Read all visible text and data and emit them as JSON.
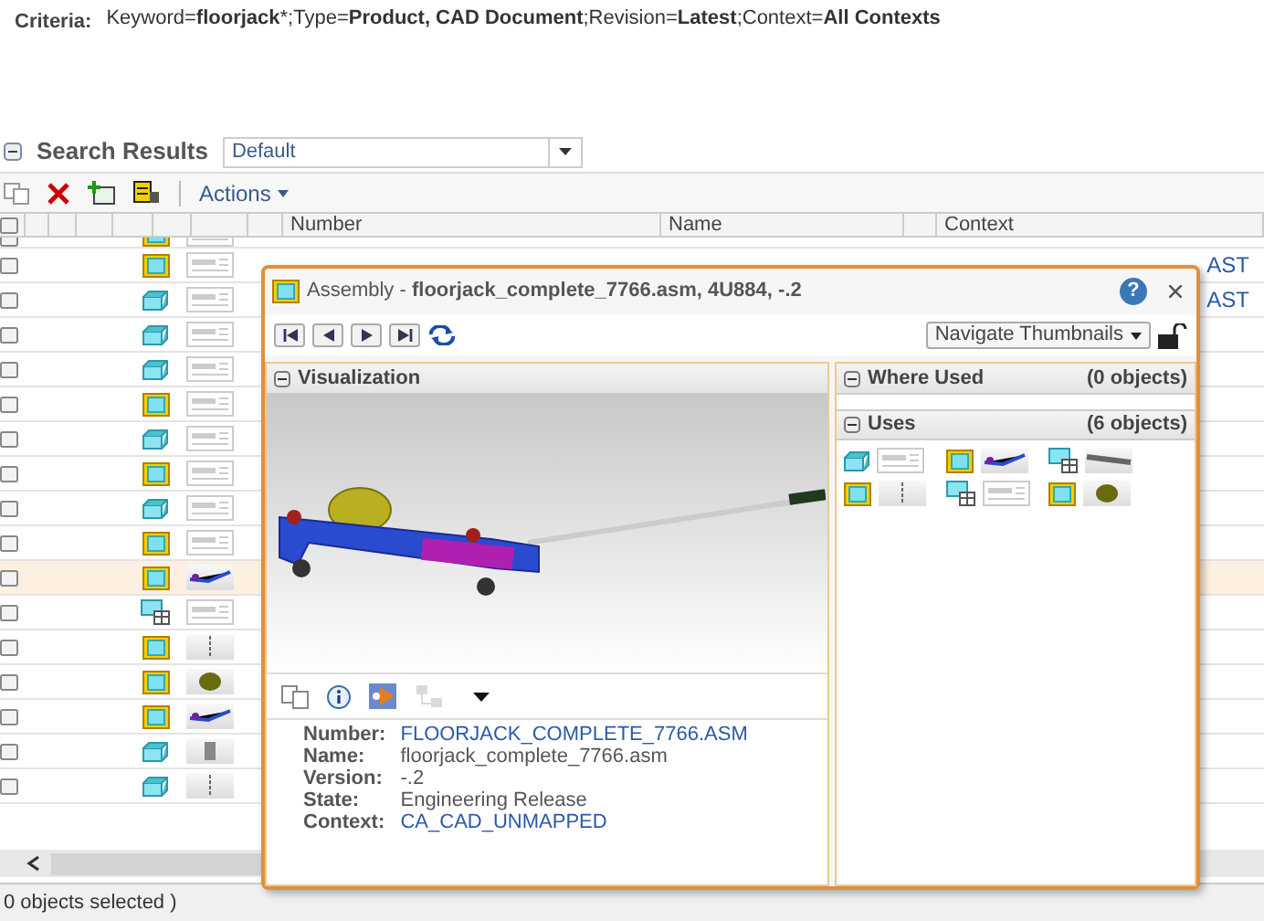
{
  "criteria": {
    "label": "Criteria:",
    "text": "Keyword=**floorjack***;Type=**Product, CAD Document**;Revision=**Latest**;Context=**All Contexts**"
  },
  "search_results": {
    "title": "Search Results",
    "view": "Default"
  },
  "toolbar": {
    "actions": "Actions"
  },
  "table": {
    "select_all_checked": false,
    "columns": [
      "Number",
      "Name",
      "Context"
    ],
    "rows": [
      {
        "cut": true,
        "kind": "assembly",
        "thumbnail": {
          "kind": "drawing"
        },
        "checked": false,
        "highlighted": false
      },
      {
        "kind": "assembly",
        "thumbnail": {
          "kind": "drawing"
        },
        "checked": false,
        "highlighted": false,
        "context": "AST"
      },
      {
        "kind": "part",
        "thumbnail": {
          "kind": "drawing"
        },
        "checked": false,
        "highlighted": false,
        "context": "AST"
      },
      {
        "kind": "part",
        "thumbnail": {
          "kind": "drawing"
        },
        "checked": false,
        "highlighted": false
      },
      {
        "kind": "part",
        "thumbnail": {
          "kind": "drawing"
        },
        "checked": false,
        "highlighted": false
      },
      {
        "kind": "assembly",
        "thumbnail": {
          "kind": "drawing"
        },
        "checked": false,
        "highlighted": false
      },
      {
        "kind": "part",
        "thumbnail": {
          "kind": "drawing"
        },
        "checked": false,
        "highlighted": false
      },
      {
        "kind": "assembly",
        "thumbnail": {
          "kind": "drawing"
        },
        "checked": false,
        "highlighted": false
      },
      {
        "kind": "part",
        "thumbnail": {
          "kind": "drawing"
        },
        "checked": false,
        "highlighted": false
      },
      {
        "kind": "assembly",
        "thumbnail": {
          "kind": "drawing"
        },
        "checked": false,
        "highlighted": false
      },
      {
        "kind": "assembly",
        "thumbnail": {
          "kind": "jack"
        },
        "checked": false,
        "highlighted": true
      },
      {
        "kind": "table",
        "thumbnail": {
          "kind": "drawing"
        },
        "checked": false,
        "highlighted": false
      },
      {
        "kind": "assembly",
        "thumbnail": {
          "kind": "rod"
        },
        "checked": false,
        "highlighted": false
      },
      {
        "kind": "assembly",
        "thumbnail": {
          "kind": "gear"
        },
        "checked": false,
        "highlighted": false
      },
      {
        "kind": "assembly",
        "thumbnail": {
          "kind": "jack"
        },
        "checked": false,
        "highlighted": false
      },
      {
        "kind": "part",
        "thumbnail": {
          "kind": "cylinder"
        },
        "checked": false,
        "highlighted": false
      },
      {
        "kind": "part",
        "thumbnail": {
          "kind": "rod"
        },
        "checked": false,
        "highlighted": false
      }
    ]
  },
  "status_bar": "0 objects selected )",
  "dialog": {
    "title": "Assembly - **floorjack_complete_7766.asm, 4U884, -.2**",
    "help": "?",
    "navigate": "Navigate Thumbnails",
    "visualization": {
      "title": "Visualization"
    },
    "bottom_tools": [
      {
        "kind": "copy",
        "disabled": false
      },
      {
        "kind": "info",
        "disabled": false
      },
      {
        "kind": "viewer",
        "disabled": false
      },
      {
        "kind": "structure",
        "disabled": true
      },
      {
        "kind": "menu",
        "disabled": false
      }
    ],
    "details": [
      {
        "label": "Number:",
        "value": "FLOORJACK_COMPLETE_7766.ASM",
        "link": true
      },
      {
        "label": "Name:",
        "value": "floorjack_complete_7766.asm",
        "link": false
      },
      {
        "label": "Version:",
        "value": "-.2",
        "link": false
      },
      {
        "label": "State:",
        "value": "Engineering Release",
        "link": false
      },
      {
        "label": "Context:",
        "value": "CA_CAD_UNMAPPED",
        "link": true
      }
    ],
    "where_used": {
      "title": "Where Used",
      "count": "(0 objects)"
    },
    "uses": {
      "title": "Uses",
      "count": "(6 objects)",
      "items": [
        {
          "kind": "part",
          "thumbnail": {
            "kind": "drawing"
          }
        },
        {
          "kind": "assembly",
          "thumbnail": {
            "kind": "jack"
          }
        },
        {
          "kind": "table",
          "thumbnail": {
            "kind": "bar"
          }
        },
        {
          "kind": "assembly",
          "thumbnail": {
            "kind": "rod"
          }
        },
        {
          "kind": "table",
          "thumbnail": {
            "kind": "drawing"
          }
        },
        {
          "kind": "assembly",
          "thumbnail": {
            "kind": "gear"
          }
        }
      ]
    }
  }
}
